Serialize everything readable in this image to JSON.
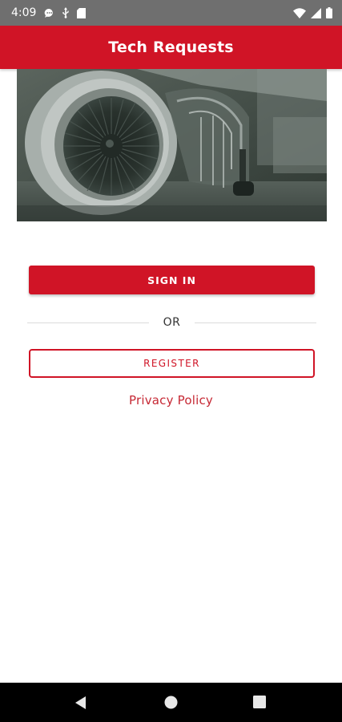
{
  "status_bar": {
    "time": "4:09",
    "left_icons": [
      "chat-bubble-icon",
      "usb-icon",
      "sd-card-icon"
    ],
    "right_icons": [
      "wifi-icon",
      "signal-icon",
      "battery-icon"
    ]
  },
  "app_bar": {
    "title": "Tech Requests",
    "color": "#d01426"
  },
  "hero": {
    "image": "jet-engine-photo"
  },
  "actions": {
    "sign_in_label": "SIGN IN",
    "or_label": "OR",
    "register_label": "REGISTER",
    "privacy_label": "Privacy Policy"
  },
  "nav_bar": {
    "icons": [
      "back-icon",
      "home-icon",
      "recents-icon"
    ]
  },
  "colors": {
    "accent": "#d01426",
    "status_bar": "#6f6f6f",
    "nav_bar": "#000000"
  }
}
